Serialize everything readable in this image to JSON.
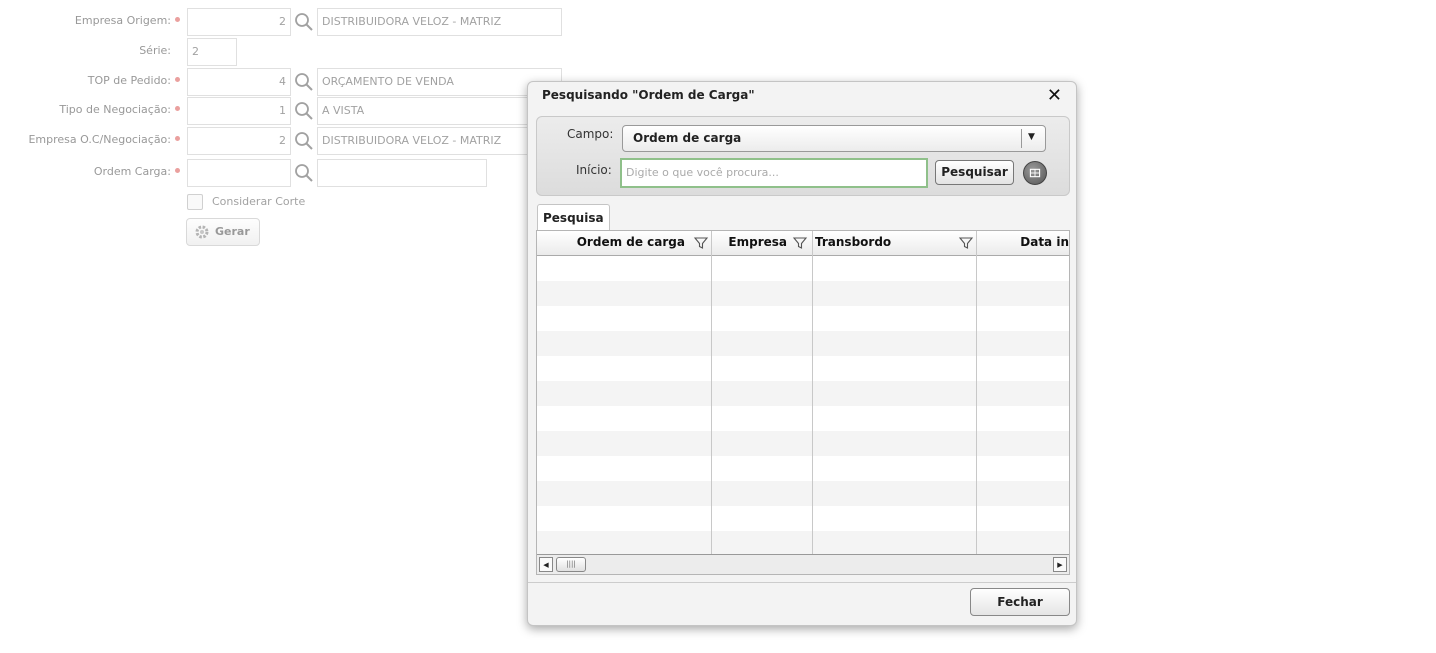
{
  "form": {
    "empresa_origem": {
      "label": "Empresa Origem:",
      "code": "2",
      "desc": "DISTRIBUIDORA VELOZ - MATRIZ"
    },
    "serie": {
      "label": "Série:",
      "value": "2"
    },
    "top_pedido": {
      "label": "TOP de Pedido:",
      "code": "4",
      "desc": "ORÇAMENTO DE VENDA"
    },
    "tipo_negociacao": {
      "label": "Tipo de Negociação:",
      "code": "1",
      "desc": "A VISTA"
    },
    "empresa_oc": {
      "label": "Empresa O.C/Negociação:",
      "code": "2",
      "desc": "DISTRIBUIDORA VELOZ - MATRIZ"
    },
    "ordem_carga": {
      "label": "Ordem Carga:",
      "code": "",
      "desc": ""
    },
    "considerar_corte": "Considerar Corte",
    "gerar": "Gerar"
  },
  "modal": {
    "title": "Pesquisando \"Ordem de Carga\"",
    "close": "✕",
    "campo_label": "Campo:",
    "campo_value": "Ordem de carga",
    "inicio_label": "Início:",
    "inicio_placeholder": "Digite o que você procura...",
    "search_button": "Pesquisar",
    "tab": "Pesquisa",
    "columns": [
      "Ordem de carga",
      "Empresa",
      "Transbordo",
      "Data in"
    ],
    "close_button": "Fechar"
  }
}
